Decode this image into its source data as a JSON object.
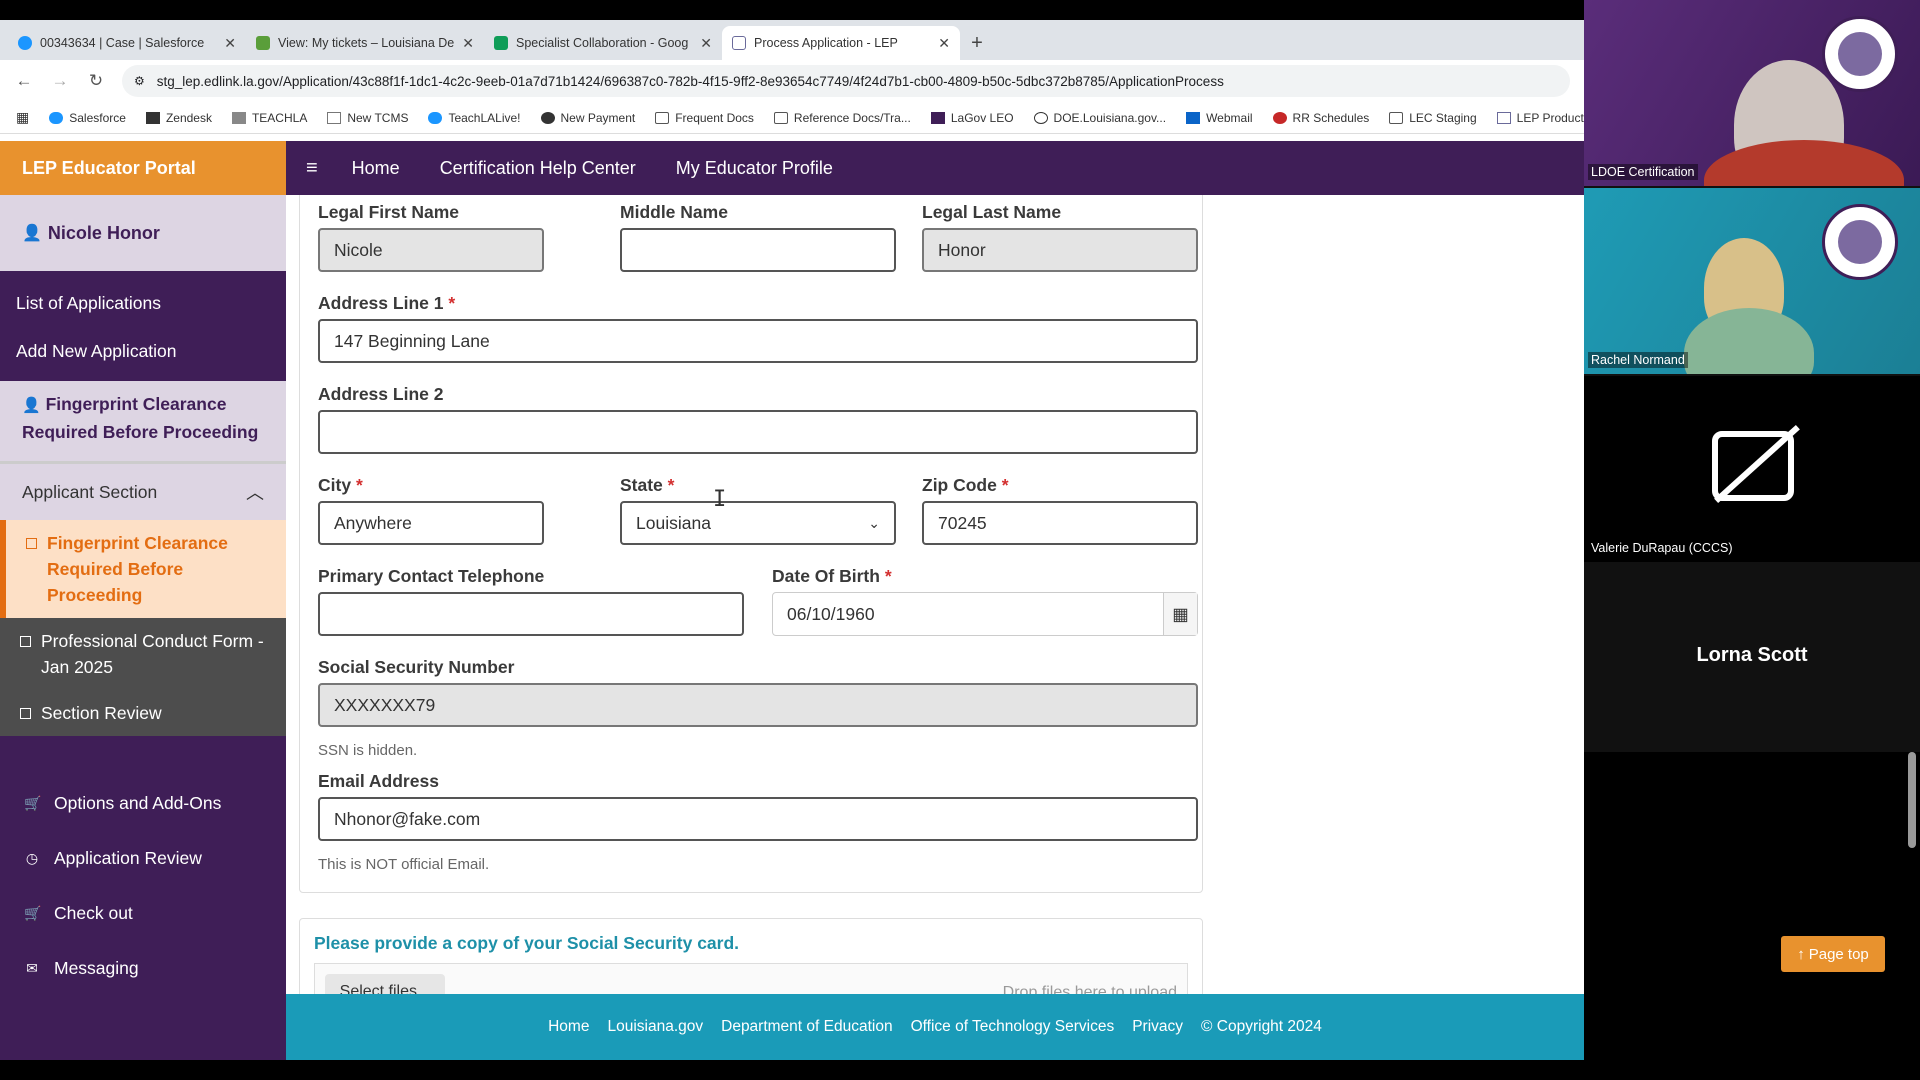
{
  "browser": {
    "tabs": [
      {
        "label": "00343634 | Case | Salesforce",
        "color": "#1b96ff"
      },
      {
        "label": "View: My tickets – Louisiana De",
        "color": "#5a9e3a"
      },
      {
        "label": "Specialist Collaboration - Goog",
        "color": "#0f9d58"
      },
      {
        "label": "Process Application - LEP",
        "color": "#6a6a9a"
      }
    ],
    "url": "stg_lep.edlink.la.gov/Application/43c88f1f-1dc1-4c2c-9eeb-01a7d71b1424/696387c0-782b-4f15-9ff2-8e93654c7749/4f24d7b1-cb00-4809-b50c-5dbc372b8785/ApplicationProcess",
    "bookmarks": [
      "Salesforce",
      "Zendesk",
      "TEACHLA",
      "New TCMS",
      "TeachLALive!",
      "New Payment",
      "Frequent Docs",
      "Reference Docs/Tra...",
      "LaGov LEO",
      "DOE.Louisiana.gov...",
      "Webmail",
      "RR Schedules",
      "LEC Staging",
      "LEP Production"
    ]
  },
  "sidebar": {
    "brand": "LEP Educator Portal",
    "user_name": "Nicole Honor",
    "links": [
      "List of Applications",
      "Add New Application"
    ],
    "fingerprint_notice": "Fingerprint Clearance Required Before Proceeding",
    "applicant_section": {
      "title": "Applicant Section",
      "items": [
        "Fingerprint Clearance Required Before Proceeding",
        "Professional Conduct Form - Jan 2025",
        "Section Review"
      ]
    },
    "lower": [
      "Options and Add-Ons",
      "Application Review",
      "Check out",
      "Messaging"
    ]
  },
  "topnav": [
    "Home",
    "Certification Help Center",
    "My Educator Profile"
  ],
  "form": {
    "first_name_label": "Legal First Name",
    "first_name": "Nicole",
    "middle_name_label": "Middle Name",
    "middle_name": "",
    "last_name_label": "Legal Last Name",
    "last_name": "Honor",
    "addr1_label": "Address Line 1",
    "addr1": "147 Beginning Lane",
    "addr2_label": "Address Line 2",
    "addr2": "",
    "city_label": "City",
    "city": "Anywhere",
    "state_label": "State",
    "state": "Louisiana",
    "zip_label": "Zip Code",
    "zip": "70245",
    "phone_label": "Primary Contact Telephone",
    "phone": "",
    "dob_label": "Date Of Birth",
    "dob": "06/10/1960",
    "ssn_label": "Social Security Number",
    "ssn": "XXXXXXX79",
    "ssn_help": "SSN is hidden.",
    "email_label": "Email Address",
    "email": "Nhonor@fake.com",
    "email_help": "This is NOT official Email.",
    "required_mark": "*"
  },
  "ssn_card": {
    "title": "Please provide a copy of your Social Security card.",
    "select_label": "Select files...",
    "drop_label": "Drop files here to upload"
  },
  "page_top": "Page top",
  "footer": [
    "Home",
    "Louisiana.gov",
    "Department of Education",
    "Office of Technology Services",
    "Privacy",
    "© Copyright 2024"
  ],
  "video": {
    "participants": [
      "LDOE Certification",
      "Rachel Normand",
      "Valerie DuRapau (CCCS)",
      "Lorna Scott"
    ]
  }
}
